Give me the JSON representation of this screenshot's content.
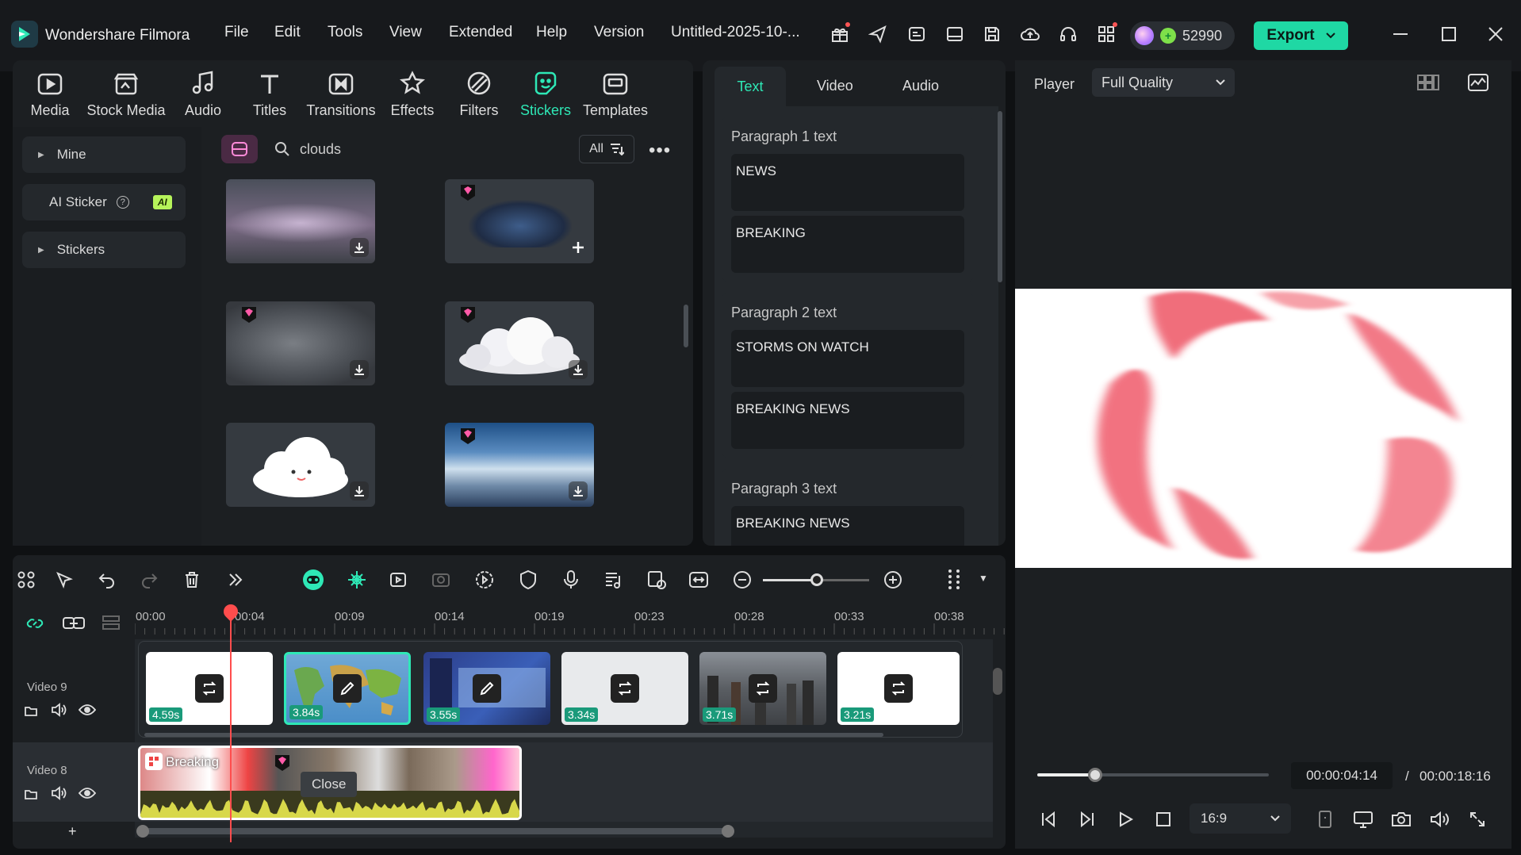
{
  "app": {
    "title": "Wondershare Filmora",
    "project": "Untitled-2025-10-...",
    "credits": "52990",
    "export_label": "Export"
  },
  "menu": [
    "File",
    "Edit",
    "Tools",
    "View",
    "Extended",
    "Help",
    "Version"
  ],
  "toolbar_tabs": [
    {
      "label": "Media",
      "icon": "media-icon"
    },
    {
      "label": "Stock Media",
      "icon": "stock-media-icon"
    },
    {
      "label": "Audio",
      "icon": "music-note-icon"
    },
    {
      "label": "Titles",
      "icon": "text-t-icon"
    },
    {
      "label": "Transitions",
      "icon": "transitions-icon"
    },
    {
      "label": "Effects",
      "icon": "effects-icon"
    },
    {
      "label": "Filters",
      "icon": "filters-icon"
    },
    {
      "label": "Stickers",
      "icon": "stickers-icon",
      "active": true
    },
    {
      "label": "Templates",
      "icon": "templates-icon"
    }
  ],
  "sidebar": {
    "items": [
      "Mine",
      "AI Sticker",
      "Stickers"
    ],
    "ai_badge": "AI"
  },
  "search": {
    "query": "clouds",
    "filter_label": "All"
  },
  "props_tabs": [
    "Text",
    "Video",
    "Audio"
  ],
  "paragraphs": [
    {
      "title": "Paragraph 1 text",
      "fields": [
        "NEWS",
        "BREAKING"
      ]
    },
    {
      "title": "Paragraph 2 text",
      "fields": [
        "STORMS ON WATCH",
        "BREAKING NEWS"
      ]
    },
    {
      "title": "Paragraph 3 text",
      "fields": [
        "BREAKING NEWS"
      ]
    }
  ],
  "player": {
    "label": "Player",
    "quality": "Full Quality",
    "current_time": "00:00:04:14",
    "separator": "/",
    "total_time": "00:00:18:16",
    "aspect": "16:9",
    "progress": 0.25
  },
  "timeline": {
    "ruler": [
      "00:00",
      "00:04",
      "00:09",
      "00:14",
      "00:19",
      "00:23",
      "00:28",
      "00:33",
      "00:38"
    ],
    "tracks": [
      {
        "name": "Video 9",
        "clips": [
          "4.59s",
          "3.84s",
          "3.55s",
          "3.34s",
          "3.71s",
          "3.21s"
        ]
      },
      {
        "name": "Video 8",
        "clip_title": "Breaking",
        "tooltip": "Close"
      }
    ],
    "add_track": "+"
  },
  "colors": {
    "accent": "#2ee8b6",
    "playhead": "#ff4d4d",
    "brand": "#1fd8a4"
  }
}
